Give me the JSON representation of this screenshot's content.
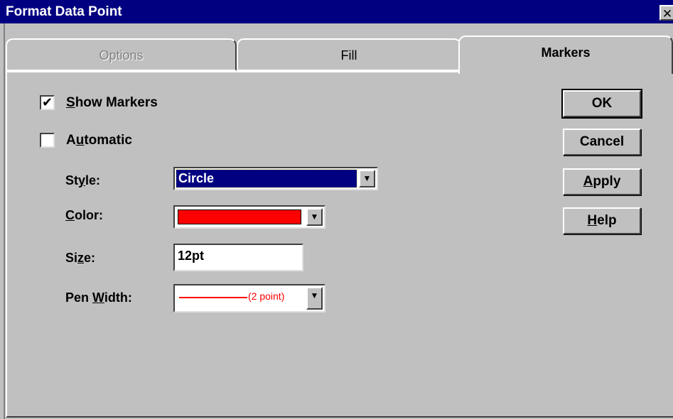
{
  "window": {
    "title": "Format Data Point",
    "close_symbol": "✕"
  },
  "tabs": [
    {
      "label": "Options",
      "state": "disabled"
    },
    {
      "label": "Fill",
      "state": "normal"
    },
    {
      "label": "Markers",
      "state": "active"
    }
  ],
  "markers": {
    "show_markers": {
      "checked": true,
      "check_glyph": "✔",
      "label_hotkey": "S",
      "label_rest": "how Markers"
    },
    "automatic": {
      "checked": false,
      "check_glyph": "",
      "label_hotkey": "u",
      "label_pre": "A",
      "label_rest": "tomatic"
    },
    "style": {
      "label_pre": "St",
      "label_hotkey": "y",
      "label_rest": "le:",
      "value": "Circle"
    },
    "color": {
      "label_pre": "",
      "label_hotkey": "C",
      "label_rest": "olor:",
      "value": "#ff0000"
    },
    "size": {
      "label_pre": "Si",
      "label_hotkey": "z",
      "label_rest": "e:",
      "value": "12pt"
    },
    "pen_width": {
      "label_pre": "Pen ",
      "label_hotkey": "W",
      "label_rest": "idth:",
      "value": "(2 point)",
      "color": "#ff0000"
    },
    "dropdown_arrow": "▼"
  },
  "buttons": {
    "ok": {
      "label": "OK"
    },
    "cancel": {
      "label": "Cancel"
    },
    "apply": {
      "hotkey": "A",
      "rest": "pply"
    },
    "help": {
      "hotkey": "H",
      "rest": "elp"
    }
  }
}
